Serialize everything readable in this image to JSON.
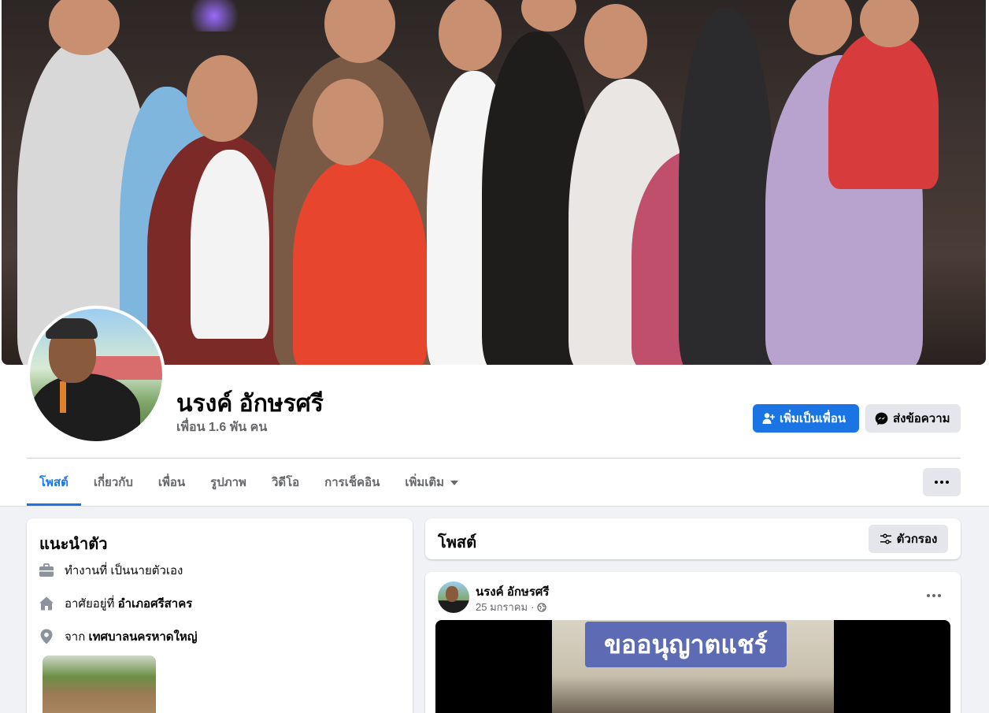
{
  "profile": {
    "name": "นรงค์ อักษรศรี",
    "friends": "เพื่อน 1.6 พัน คน"
  },
  "actions": {
    "add_friend": "เพิ่มเป็นเพื่อน",
    "message": "ส่งข้อความ"
  },
  "tabs": [
    {
      "label": "โพสต์",
      "active": true
    },
    {
      "label": "เกี่ยวกับ"
    },
    {
      "label": "เพื่อน"
    },
    {
      "label": "รูปภาพ"
    },
    {
      "label": "วิดีโอ"
    },
    {
      "label": "การเช็คอิน"
    },
    {
      "label": "เพิ่มเติม"
    }
  ],
  "intro": {
    "title": "แนะนำตัว",
    "work_prefix": "ทำงานที่",
    "work": "เป็นนายตัวเอง",
    "lives_prefix": "อาศัยอยู่ที่",
    "lives": "อำเภอศรีสาคร",
    "from_prefix": "จาก",
    "from": "เทศบาลนครหาดใหญ่"
  },
  "posts": {
    "title": "โพสต์",
    "filter": "ตัวกรอง"
  },
  "post": {
    "author": "นรงค์ อักษรศรี",
    "date": "25 มกราคม",
    "separator": "·",
    "caption": "ขออนุญาตแชร์"
  },
  "colors": {
    "accent": "#1b74e4",
    "secondary_button": "#e4e6eb",
    "page_bg": "#f0f2f5",
    "muted_text": "#65676b"
  },
  "icons": {
    "add_friend": "person-plus-icon",
    "message": "messenger-icon",
    "more": "more-dots-icon",
    "work": "briefcase-icon",
    "home": "home-icon",
    "location": "location-pin-icon",
    "filter": "sliders-icon",
    "privacy": "globe-icon",
    "dropdown": "caret-down-icon"
  }
}
